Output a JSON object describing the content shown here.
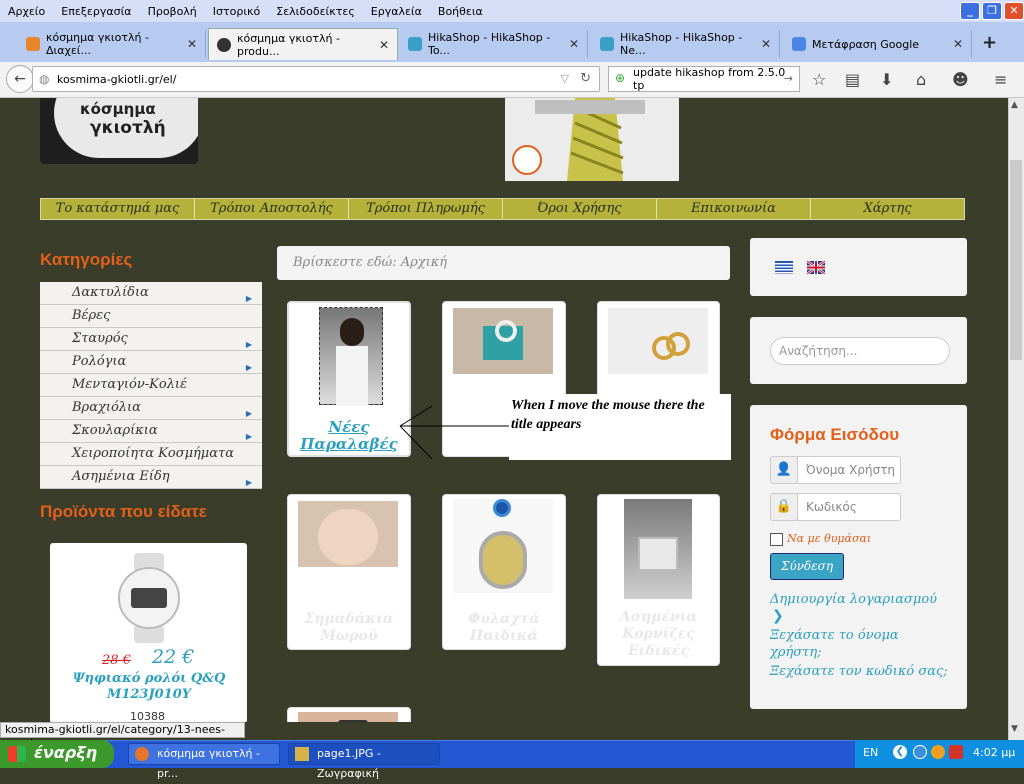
{
  "menubar": {
    "items": [
      "Αρχείο",
      "Επεξεργασία",
      "Προβολή",
      "Ιστορικό",
      "Σελιδοδείκτες",
      "Εργαλεία",
      "Βοήθεια"
    ]
  },
  "tabs": [
    {
      "label": "κόσμημα γκιοτλή - Διαχεί...",
      "active": false
    },
    {
      "label": "κόσμημα γκιοτλή - produ...",
      "active": true
    },
    {
      "label": "HikaShop - HikaShop - To...",
      "active": false
    },
    {
      "label": "HikaShop - HikaShop - Ne...",
      "active": false
    },
    {
      "label": "Μετάφραση Google",
      "active": false
    }
  ],
  "new_tab": "+",
  "address": {
    "url": "kosmima-gkiotli.gr/el/"
  },
  "search": {
    "value": "update hikashop from 2.5.0 tp"
  },
  "site": {
    "menu": [
      "Το κατάστημά μας",
      "Τρόποι Αποστολής",
      "Τρόποι Πληρωμής",
      "Όροι Χρήσης",
      "Επικοινωνία",
      "Χάρτης"
    ],
    "categories_title": "Κατηγορίες",
    "categories": [
      {
        "label": "Δακτυλίδια",
        "sub": true
      },
      {
        "label": "Βέρες",
        "sub": false
      },
      {
        "label": "Σταυρός",
        "sub": true
      },
      {
        "label": "Ρολόγια",
        "sub": true
      },
      {
        "label": "Μενταγιόν-Κολιέ",
        "sub": false
      },
      {
        "label": "Βραχιόλια",
        "sub": true
      },
      {
        "label": "Σκουλαρίκια",
        "sub": true
      },
      {
        "label": "Χειροποίητα Κοσμήματα",
        "sub": false
      },
      {
        "label": "Ασημένια Είδη",
        "sub": true
      }
    ],
    "viewed_title": "Προϊόντα που είδατε",
    "viewed_product": {
      "old_price": "28 €",
      "new_price": "22 €",
      "name": "Ψηφιακό ρολόι Q&Q M123J010Y",
      "code": "10388"
    },
    "breadcrumb": "Βρίσκεστε εδώ:  Αρχική",
    "products": [
      {
        "name": "Νέες Παραλαβές"
      },
      {
        "name": ""
      },
      {
        "name": ""
      },
      {
        "name": "Σημαδάκια Μωρού"
      },
      {
        "name": "Φυλαχτά Παιδικά"
      },
      {
        "name": "Ασημένια Κορνίζες Ειδικές"
      }
    ],
    "annotation": "When I move the mouse there the title appears",
    "search_placeholder": "Αναζήτηση...",
    "login": {
      "title": "Φόρμα Εισόδου",
      "username_placeholder": "Όνομα Χρήστη",
      "password_placeholder": "Κωδικός",
      "remember": "Να με θυμάσαι",
      "submit": "Σύνδεση",
      "create": "Δημιουργία λογαριασμού",
      "forgot_user": "Ξεχάσατε το όνομα χρήστη;",
      "forgot_pass": "Ξεχάσατε τον κωδικό σας;"
    }
  },
  "status_url": "kosmima-gkiotli.gr/el/category/13-nees-paralaves",
  "taskbar": {
    "start": "έναρξη",
    "tasks": [
      "κόσμημα γκιοτλή - pr...",
      "page1.JPG - Ζωγραφική"
    ],
    "lang": "EN",
    "clock": "4:02 μμ"
  },
  "colors": {
    "page_bg": "#3a3d2a",
    "menu_bg": "#b5b23c",
    "accent": "#e1601a",
    "link": "#2a9fbf"
  }
}
